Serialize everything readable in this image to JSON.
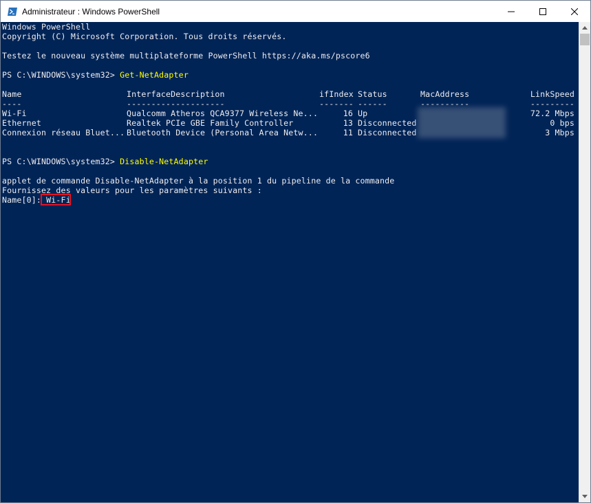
{
  "window": {
    "title": "Administrateur : Windows PowerShell",
    "icon": "powershell-icon",
    "controls": [
      "minimize-icon",
      "maximize-icon",
      "close-icon"
    ]
  },
  "console": {
    "intro": [
      "Windows PowerShell",
      "Copyright (C) Microsoft Corporation. Tous droits réservés.",
      "Testez le nouveau système multiplateforme PowerShell https://aka.ms/pscore6"
    ],
    "prompt": "PS C:\\WINDOWS\\system32> ",
    "command1": "Get-NetAdapter",
    "table": {
      "headers": [
        "Name",
        "InterfaceDescription",
        "ifIndex",
        "Status",
        "MacAddress",
        "LinkSpeed"
      ],
      "separators": [
        "----",
        "--------------------",
        "-------",
        "------",
        "----------",
        "---------"
      ],
      "rows": [
        {
          "name": "Wi-Fi",
          "desc": "Qualcomm Atheros QCA9377 Wireless Ne...",
          "ifindex": "16",
          "status": "Up",
          "mac": "",
          "speed": "72.2 Mbps"
        },
        {
          "name": "Ethernet",
          "desc": "Realtek PCIe GBE Family Controller",
          "ifindex": "13",
          "status": "Disconnected",
          "mac": "",
          "speed": "0 bps"
        },
        {
          "name": "Connexion réseau Bluet...",
          "desc": "Bluetooth Device (Personal Area Netw...",
          "ifindex": "11",
          "status": "Disconnected",
          "mac": "",
          "speed": "3 Mbps"
        }
      ]
    },
    "command2": "Disable-NetAdapter",
    "msg1": "applet de commande Disable-NetAdapter à la position 1 du pipeline de la commande",
    "msg2": "Fournissez des valeurs pour les paramètres suivants :",
    "input_label": "Name[0]: ",
    "input_value": "Wi-Fi"
  },
  "colors": {
    "background": "#012456",
    "text": "#eeedf0",
    "command": "#ffff00",
    "highlight": "#e81123"
  }
}
